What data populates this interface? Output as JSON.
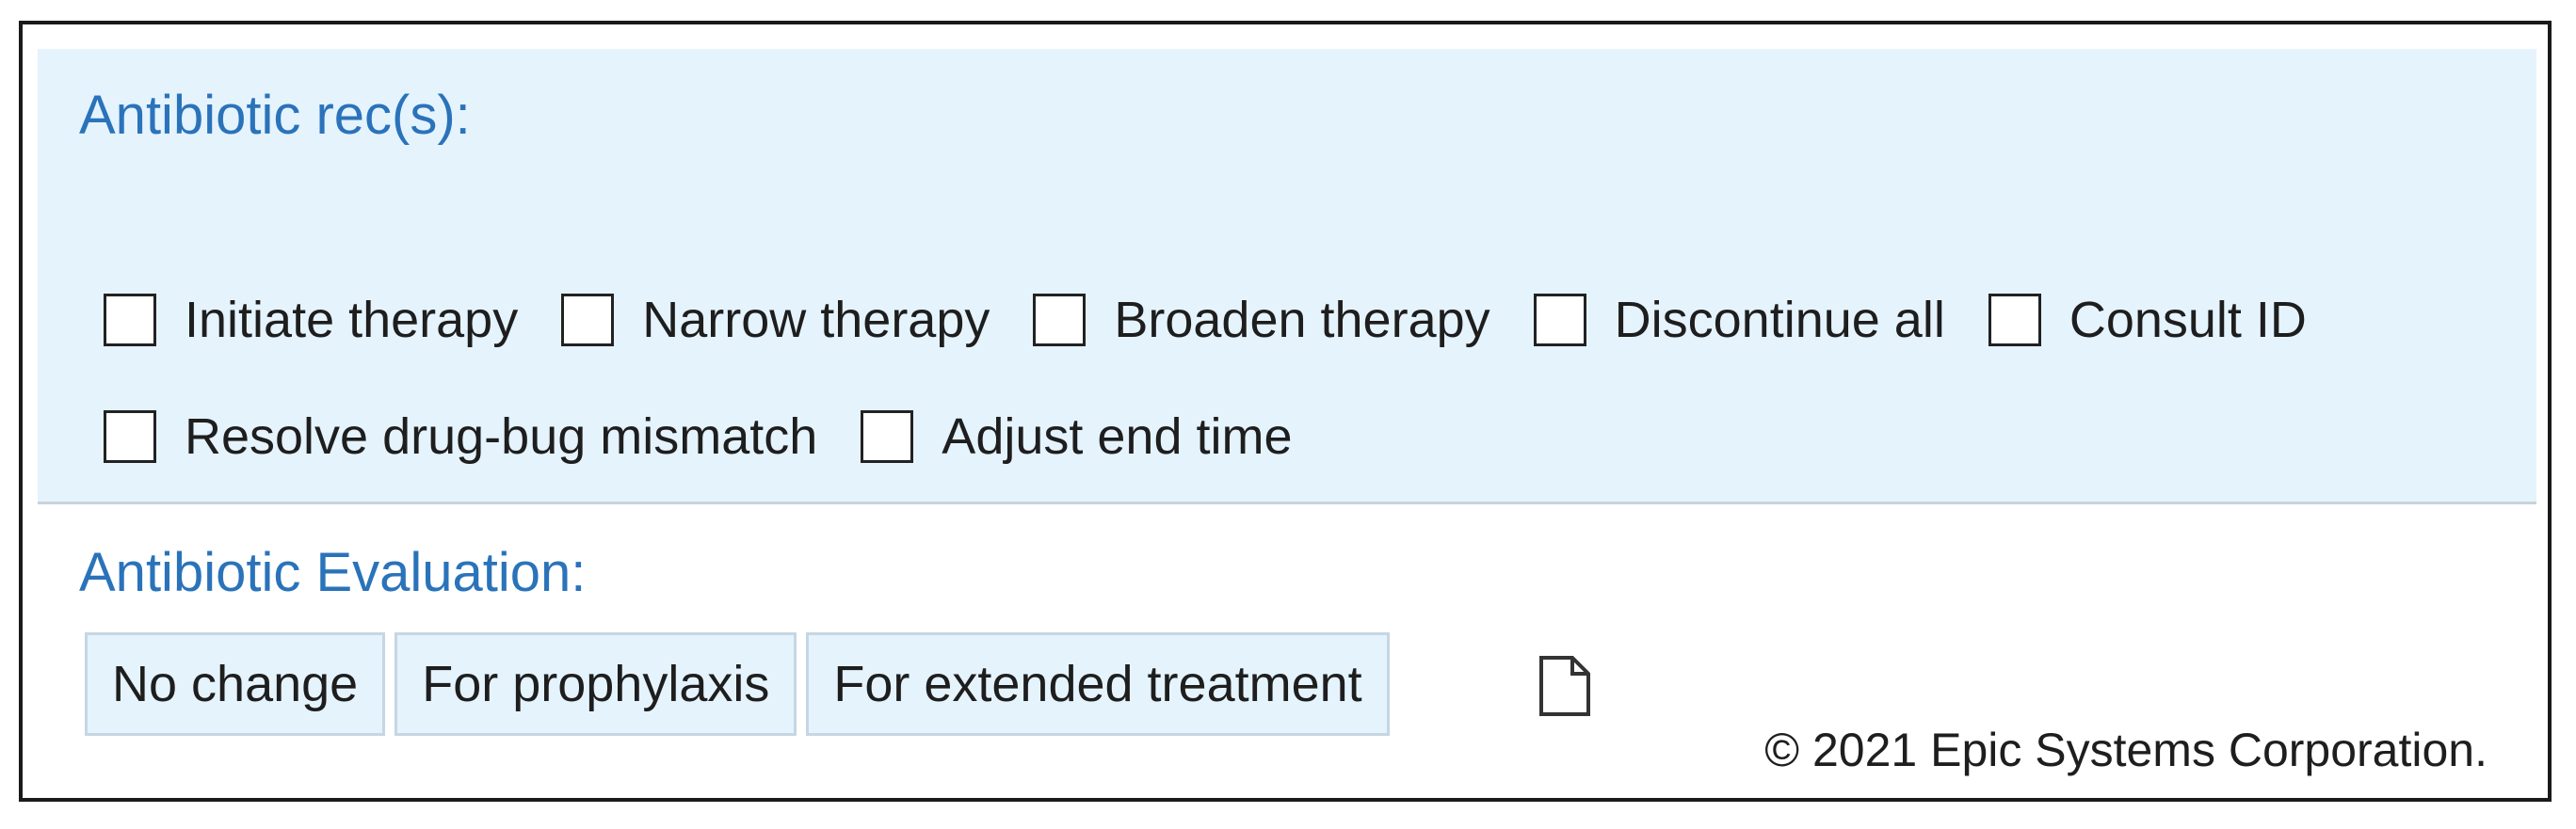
{
  "rec_section": {
    "title": "Antibiotic rec(s):",
    "options_row1": [
      {
        "label": "Initiate therapy",
        "checked": false
      },
      {
        "label": "Narrow therapy",
        "checked": false
      },
      {
        "label": "Broaden therapy",
        "checked": false
      },
      {
        "label": "Discontinue all",
        "checked": false
      },
      {
        "label": "Consult ID",
        "checked": false
      }
    ],
    "options_row2": [
      {
        "label": "Resolve drug-bug mismatch",
        "checked": false
      },
      {
        "label": "Adjust end time",
        "checked": false
      }
    ]
  },
  "eval_section": {
    "title": "Antibiotic Evaluation:",
    "buttons": [
      {
        "label": "No change"
      },
      {
        "label": "For prophylaxis"
      },
      {
        "label": "For extended treatment"
      }
    ],
    "note_icon": "document-icon"
  },
  "footer": {
    "copyright": "© 2021 Epic Systems Corporation."
  },
  "colors": {
    "title_blue": "#2a73ba",
    "panel_bg": "#e5f3fd",
    "button_border": "#c6d6e3"
  }
}
